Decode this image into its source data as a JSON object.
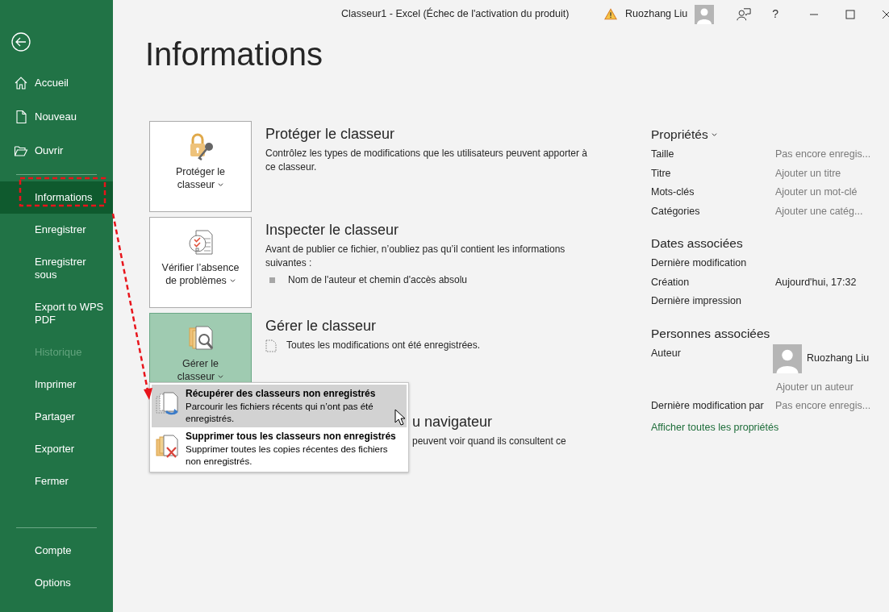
{
  "window": {
    "title": "Classeur1  -  Excel (Échec de l'activation du produit)",
    "warning": true,
    "user_name": "Ruozhang Liu",
    "help": "?"
  },
  "sidebar": {
    "groups": [
      [
        {
          "label": "Accueil",
          "selected": false,
          "disabled": false
        },
        {
          "label": "Nouveau",
          "selected": false,
          "disabled": false
        },
        {
          "label": "Ouvrir",
          "selected": false,
          "disabled": false
        }
      ],
      [
        {
          "label": "Informations",
          "selected": true,
          "disabled": false
        },
        {
          "label": "Enregistrer",
          "selected": false,
          "disabled": false
        },
        {
          "label": "Enregistrer sous",
          "selected": false,
          "disabled": false
        },
        {
          "label": "Export to WPS PDF",
          "selected": false,
          "disabled": false
        },
        {
          "label": "Historique",
          "selected": false,
          "disabled": true
        },
        {
          "label": "Imprimer",
          "selected": false,
          "disabled": false
        },
        {
          "label": "Partager",
          "selected": false,
          "disabled": false
        },
        {
          "label": "Exporter",
          "selected": false,
          "disabled": false
        },
        {
          "label": "Fermer",
          "selected": false,
          "disabled": false
        }
      ],
      [
        {
          "label": "Compte",
          "selected": false,
          "disabled": false
        },
        {
          "label": "Options",
          "selected": false,
          "disabled": false
        }
      ]
    ]
  },
  "page_title": "Informations",
  "sections": [
    {
      "kind": "full",
      "button_lines": [
        "Protéger le",
        "classeur"
      ],
      "pressed": false,
      "title": "Protéger le classeur",
      "description": "Contrôlez les types de modifications que les utilisateurs peuvent apporter à ce classeur."
    },
    {
      "kind": "full",
      "button_lines": [
        "Vérifier l’absence",
        "de problèmes"
      ],
      "pressed": false,
      "title": "Inspecter le classeur",
      "description": "Avant de publier ce fichier, n’oubliez pas qu’il contient les informations suivantes :",
      "bullets": [
        "Nom de l'auteur et chemin d'accès absolu"
      ]
    },
    {
      "kind": "full",
      "button_lines": [
        "Gérer le",
        "classeur"
      ],
      "pressed": true,
      "title": "Gérer le classeur",
      "note": "Toutes les modifications ont été enregistrées."
    },
    {
      "kind": "covered",
      "title": "u navigateur",
      "description": "peuvent voir quand ils consultent ce"
    }
  ],
  "manage_menu": {
    "items": [
      {
        "title": "Récupérer des classeurs non enregistrés",
        "description": "Parcourir les fichiers récents qui n’ont pas été enregistrés.",
        "selected": true
      },
      {
        "title": "Supprimer tous les classeurs non enregistrés",
        "description": "Supprimer toutes les copies récentes des fichiers non enregistrés.",
        "selected": false
      }
    ]
  },
  "properties": {
    "heading": "Propriétés",
    "rows": [
      {
        "label": "Taille",
        "value": "Pas encore enregis...",
        "muted": true
      },
      {
        "label": "Titre",
        "value": "Ajouter un titre",
        "muted": true
      },
      {
        "label": "Mots-clés",
        "value": "Ajouter un mot-clé",
        "muted": true
      },
      {
        "label": "Catégories",
        "value": "Ajouter une catég...",
        "muted": true
      }
    ]
  },
  "dates": {
    "heading": "Dates associées",
    "rows": [
      {
        "label": "Dernière modification"
      },
      {
        "label": "Création",
        "value": "Aujourd'hui, 17:32",
        "muted": false
      },
      {
        "label": "Dernière impression"
      }
    ]
  },
  "people": {
    "heading": "Personnes associées",
    "author_label": "Auteur",
    "author_name": "Ruozhang Liu",
    "add_author": "Ajouter un auteur",
    "rows": [
      {
        "label": "Dernière modification par",
        "value": "Pas encore enregis...",
        "muted": true
      }
    ]
  },
  "show_all_link": "Afficher toutes les propriétés"
}
